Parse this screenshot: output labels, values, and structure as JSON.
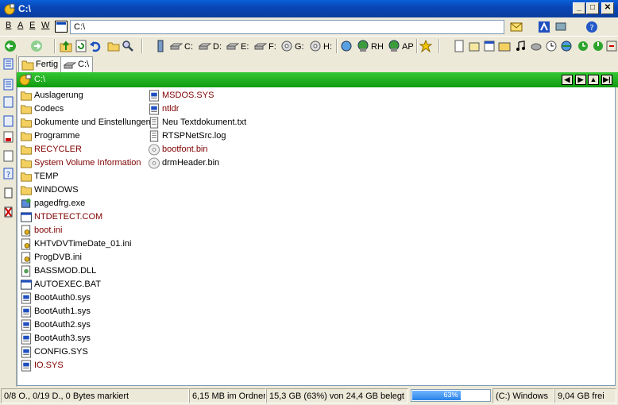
{
  "window": {
    "title": "C:\\"
  },
  "menu": [
    "B",
    "A",
    "E",
    "W"
  ],
  "address": {
    "value": "C:\\"
  },
  "toolbar": {
    "drives": [
      "C:",
      "D:",
      "E:",
      "F:",
      "G:",
      "H:"
    ],
    "net": [
      "RH",
      "AP"
    ]
  },
  "tabs": [
    {
      "label": "Fertig"
    },
    {
      "label": "C:\\"
    }
  ],
  "path": {
    "label": "C:\\"
  },
  "files": {
    "col1": [
      {
        "name": "Auslagerung",
        "type": "folder"
      },
      {
        "name": "Codecs",
        "type": "folder"
      },
      {
        "name": "Dokumente und Einstellungen",
        "type": "folder"
      },
      {
        "name": "Programme",
        "type": "folder"
      },
      {
        "name": "RECYCLER",
        "type": "folder"
      },
      {
        "name": "System Volume Information",
        "type": "folder"
      },
      {
        "name": "TEMP",
        "type": "folder"
      },
      {
        "name": "WINDOWS",
        "type": "folder"
      },
      {
        "name": "pagedfrg.exe",
        "type": "exe"
      },
      {
        "name": "NTDETECT.COM",
        "type": "com"
      },
      {
        "name": "boot.ini",
        "type": "ini"
      },
      {
        "name": "KHTvDVTimeDate_01.ini",
        "type": "ini"
      },
      {
        "name": "ProgDVB.ini",
        "type": "ini"
      },
      {
        "name": "BASSMOD.DLL",
        "type": "dll"
      },
      {
        "name": "AUTOEXEC.BAT",
        "type": "bat"
      },
      {
        "name": "BootAuth0.sys",
        "type": "sys"
      },
      {
        "name": "BootAuth1.sys",
        "type": "sys"
      },
      {
        "name": "BootAuth2.sys",
        "type": "sys"
      },
      {
        "name": "BootAuth3.sys",
        "type": "sys"
      },
      {
        "name": "CONFIG.SYS",
        "type": "sys"
      },
      {
        "name": "IO.SYS",
        "type": "sys"
      }
    ],
    "col2": [
      {
        "name": "MSDOS.SYS",
        "type": "sys"
      },
      {
        "name": "ntldr",
        "type": "sys"
      },
      {
        "name": "Neu Textdokument.txt",
        "type": "txt"
      },
      {
        "name": "RTSPNetSrc.log",
        "type": "txt"
      },
      {
        "name": "bootfont.bin",
        "type": "bin"
      },
      {
        "name": "drmHeader.bin",
        "type": "bin"
      }
    ]
  },
  "status": {
    "selection": "0/8 O., 0/19 D., 0 Bytes markiert",
    "folder_size": "6,15 MB im Ordner",
    "usage": "15,3 GB (63%) von 24,4 GB belegt",
    "progress_label": "63%",
    "progress": 0.63,
    "drive": "(C:) Windows",
    "free": "9,04 GB frei"
  },
  "colors": {
    "title": "#0846b8",
    "path_bar": "#1aa81a",
    "hidden_file": "#800000",
    "progress": "#2a83e8"
  }
}
